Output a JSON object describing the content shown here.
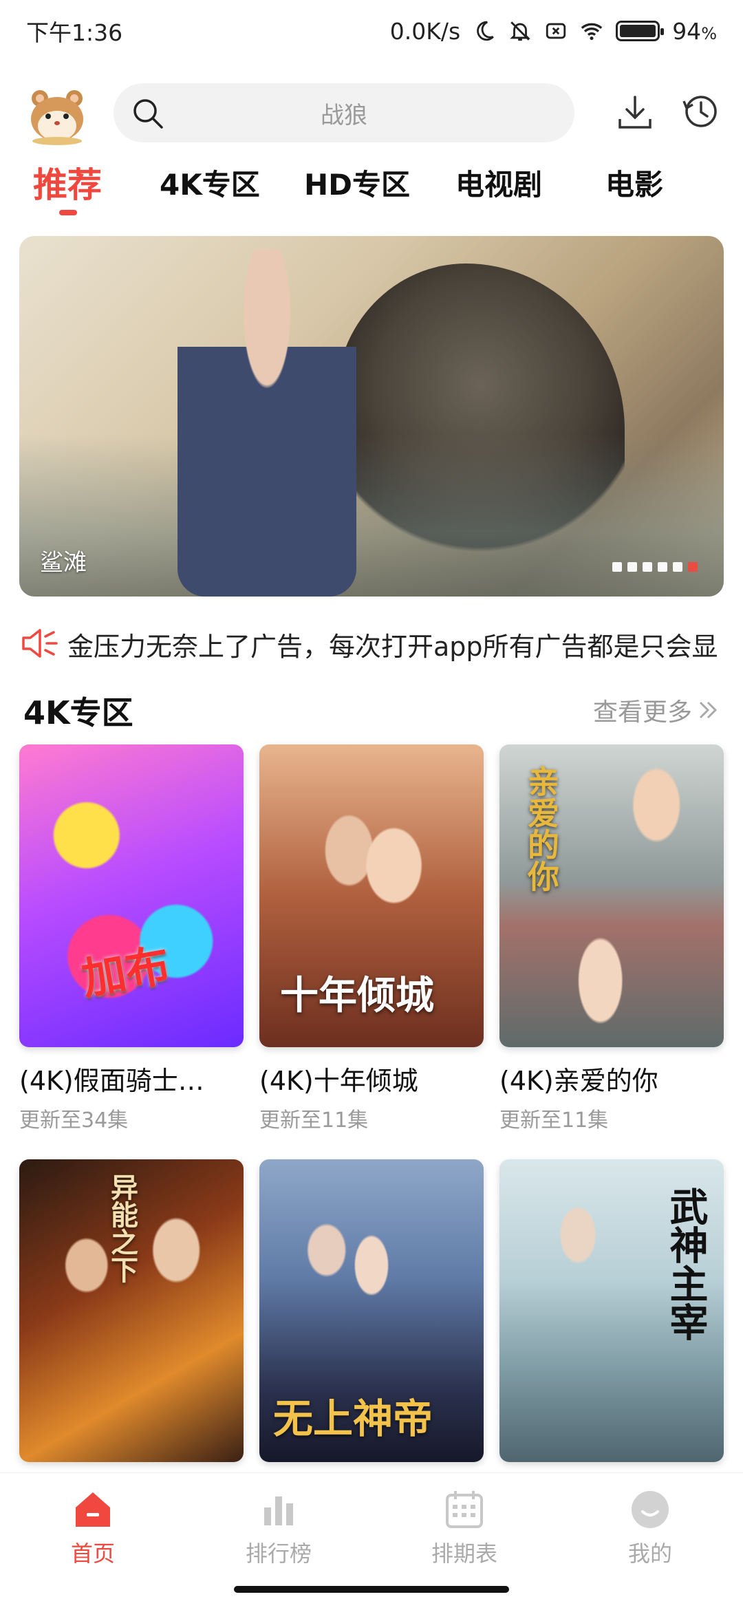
{
  "status_bar": {
    "time": "下午1:36",
    "net_speed": "0.0K/s",
    "battery": "94",
    "battery_unit": "%"
  },
  "header": {
    "search_placeholder": "战狼"
  },
  "tabs": [
    "推荐",
    "4K专区",
    "HD专区",
    "电视剧",
    "电影"
  ],
  "banner": {
    "caption": "鲨滩",
    "dots_total": 6,
    "active_dot": 6
  },
  "notice": {
    "text": "金压力无奈上了广告，每次打开app所有广告都是只会显"
  },
  "section": {
    "title": "4K专区",
    "more": "查看更多"
  },
  "cards": [
    {
      "title": "(4K)假面骑士…",
      "sub": "更新至34集",
      "poster_text": "加布"
    },
    {
      "title": "(4K)十年倾城",
      "sub": "更新至11集",
      "poster_text": "十年倾城"
    },
    {
      "title": "(4K)亲爱的你",
      "sub": "更新至11集",
      "poster_text": "亲爱的你"
    },
    {
      "title": "",
      "sub": "",
      "poster_text": "异能之下"
    },
    {
      "title": "",
      "sub": "",
      "poster_text": "无上神帝"
    },
    {
      "title": "",
      "sub": "",
      "poster_text": "武神主宰"
    }
  ],
  "bottom_nav": [
    {
      "label": "首页",
      "icon": "home-icon"
    },
    {
      "label": "排行榜",
      "icon": "chart-icon"
    },
    {
      "label": "排期表",
      "icon": "calendar-icon"
    },
    {
      "label": "我的",
      "icon": "profile-icon"
    }
  ],
  "colors": {
    "accent": "#f0483e"
  }
}
